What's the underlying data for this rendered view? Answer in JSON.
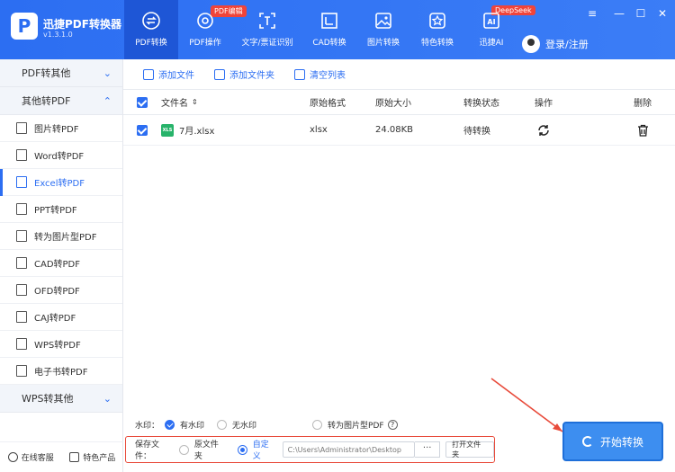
{
  "app": {
    "name": "迅捷PDF转换器",
    "version": "v1.3.1.0",
    "logo_letter": "P"
  },
  "nav": [
    {
      "label": "PDF转换",
      "icon": "convert-icon",
      "active": true,
      "badge": ""
    },
    {
      "label": "PDF操作",
      "icon": "pdf-operate-icon",
      "active": false,
      "badge": "PDF编辑"
    },
    {
      "label": "文字/票证识别",
      "icon": "ocr-icon",
      "active": false,
      "badge": ""
    },
    {
      "label": "CAD转换",
      "icon": "cad-icon",
      "active": false,
      "badge": ""
    },
    {
      "label": "图片转换",
      "icon": "image-icon",
      "active": false,
      "badge": ""
    },
    {
      "label": "特色转换",
      "icon": "star-icon",
      "active": false,
      "badge": ""
    },
    {
      "label": "迅捷AI",
      "icon": "ai-icon",
      "active": false,
      "badge": "DeepSeek"
    }
  ],
  "user": {
    "label": "登录/注册"
  },
  "window": {
    "menu": "≡",
    "minimize": "—",
    "maximize": "☐",
    "close": "✕"
  },
  "sidebar": {
    "cat1": "PDF转其他",
    "cat2": "其他转PDF",
    "items": [
      "图片转PDF",
      "Word转PDF",
      "Excel转PDF",
      "PPT转PDF",
      "转为图片型PDF",
      "CAD转PDF",
      "OFD转PDF",
      "CAJ转PDF",
      "WPS转PDF",
      "电子书转PDF"
    ],
    "active_index": 2,
    "cat3": "WPS转其他",
    "footer": {
      "support": "在线客服",
      "products": "特色产品"
    }
  },
  "toolbar": {
    "add_file": "添加文件",
    "add_folder": "添加文件夹",
    "clear": "清空列表"
  },
  "table": {
    "headers": {
      "name": "文件名",
      "format": "原始格式",
      "size": "原始大小",
      "status": "转换状态",
      "action": "操作",
      "delete": "删除"
    },
    "rows": [
      {
        "name": "7月.xlsx",
        "icon_text": "XLS",
        "format": "xlsx",
        "size": "24.08KB",
        "status": "待转换"
      }
    ]
  },
  "watermark": {
    "label": "水印：",
    "with": "有水印",
    "without": "无水印",
    "image_pdf": "转为图片型PDF",
    "help": "?"
  },
  "save": {
    "label": "保存文件：",
    "original": "原文件夹",
    "custom": "自定义",
    "path": "C:\\Users\\Administrator\\Desktop",
    "browse": "···",
    "open": "打开文件夹"
  },
  "start": {
    "label": "开始转换"
  },
  "colors": {
    "primary": "#2c6ef2",
    "highlight": "#e84a3a"
  }
}
